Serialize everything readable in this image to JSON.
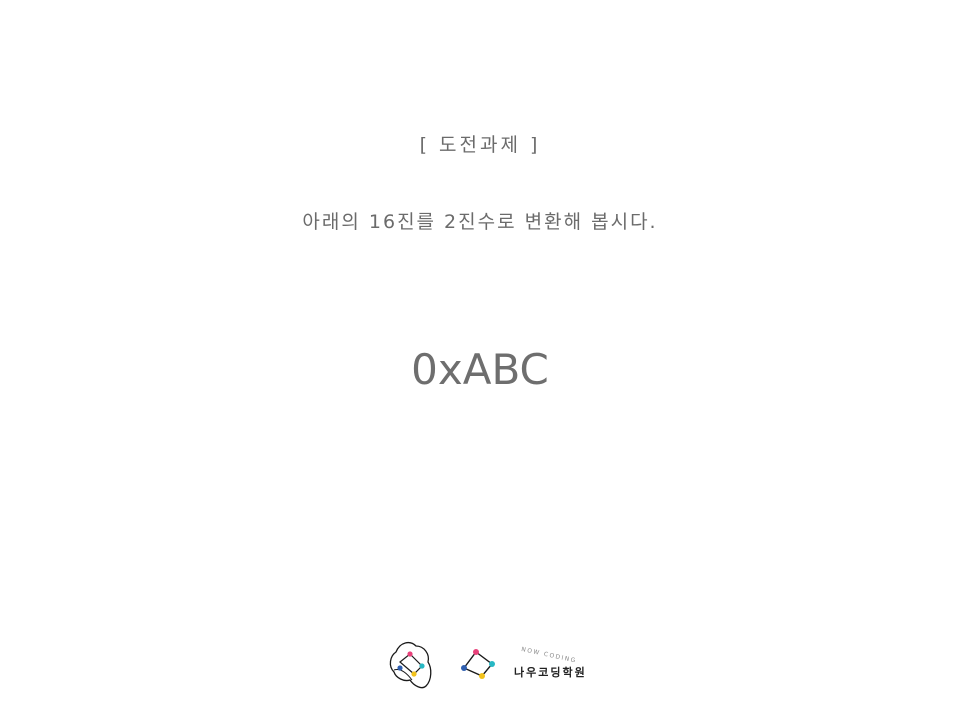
{
  "slide": {
    "heading": "[ 도전과제 ]",
    "instruction": "아래의 16진를 2진수로 변환해 봅시다.",
    "value": "0xABC"
  },
  "footer": {
    "brand_name": "나우코딩학원",
    "brand_tagline": "NOW CODING",
    "colors": {
      "pink": "#e8417a",
      "teal": "#27b8c4",
      "yellow": "#f2c21b",
      "blue": "#2f5fb0",
      "line": "#1a1a1a"
    }
  }
}
